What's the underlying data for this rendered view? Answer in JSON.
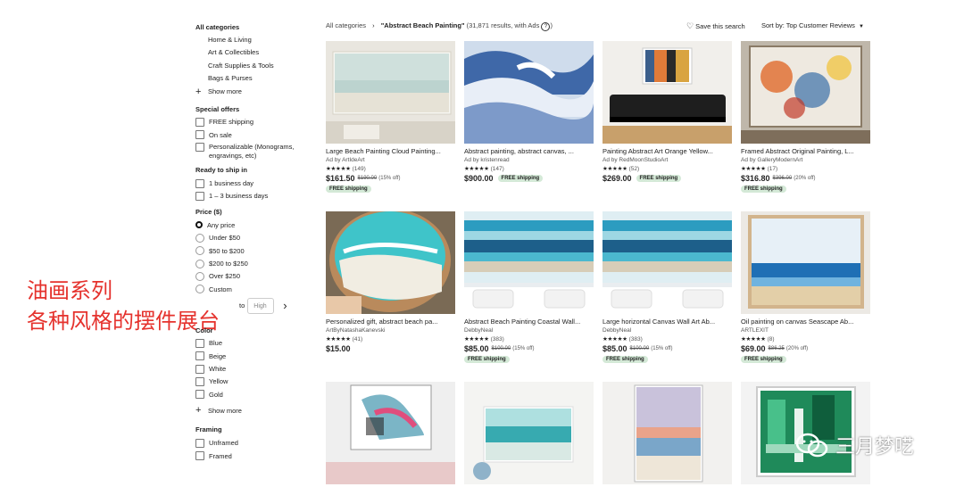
{
  "overlay": {
    "line1": "油画系列",
    "line2": "各种风格的摆件展台"
  },
  "watermark": {
    "icon": "wechat-icon",
    "text": "三月梦呓"
  },
  "sidebar": {
    "categories_title": "All categories",
    "categories": [
      "Home & Living",
      "Art & Collectibles",
      "Craft Supplies & Tools",
      "Bags & Purses"
    ],
    "show_more": "Show more",
    "special_title": "Special offers",
    "special": [
      "FREE shipping",
      "On sale",
      "Personalizable (Monograms, engravings, etc)"
    ],
    "ship_title": "Ready to ship in",
    "ship": [
      "1 business day",
      "1 – 3 business days"
    ],
    "price_title": "Price ($)",
    "price": [
      "Any price",
      "Under $50",
      "$50 to $200",
      "$200 to $250",
      "Over $250",
      "Custom"
    ],
    "price_to": "to",
    "price_high_placeholder": "High",
    "color_title": "Color",
    "colors": [
      "Blue",
      "Beige",
      "White",
      "Yellow",
      "Gold"
    ],
    "color_show_more": "Show more",
    "framing_title": "Framing",
    "framing": [
      "Unframed",
      "Framed"
    ]
  },
  "header": {
    "breadcrumb_root": "All categories",
    "breadcrumb_sep": "›",
    "query": "\"Abstract Beach Painting\"",
    "results": "(31,871 results, with Ads",
    "save_search": "Save this search",
    "sort": "Sort by: Top Customer Reviews"
  },
  "listings": [
    {
      "title": "Large Beach Painting Cloud Painting...",
      "shop": "Ad by ArtIdeArt",
      "stars": "★★★★★",
      "reviews": "(149)",
      "price": "$161.50",
      "orig": "$190.00",
      "off": "(15% off)",
      "ship": "FREE shipping",
      "ship_line": true
    },
    {
      "title": "Abstract painting, abstract canvas, ...",
      "shop": "Ad by kristenread",
      "stars": "★★★★★",
      "reviews": "(147)",
      "price": "$900.00",
      "orig": "",
      "off": "",
      "ship": "FREE shipping",
      "ship_line": false
    },
    {
      "title": "Painting Abstract Art Orange Yellow...",
      "shop": "Ad by RedMoonStudioArt",
      "stars": "★★★★★",
      "reviews": "(52)",
      "price": "$269.00",
      "orig": "",
      "off": "",
      "ship": "FREE shipping",
      "ship_line": false
    },
    {
      "title": "Framed Abstract Original Painting, L...",
      "shop": "Ad by GalleryModernArt",
      "stars": "★★★★★",
      "reviews": "(17)",
      "price": "$316.80",
      "orig": "$396.00",
      "off": "(20% off)",
      "ship": "FREE shipping",
      "ship_line": true
    },
    {
      "title": "Personalized gift, abstract beach pa...",
      "shop": "ArtByNatashaKanevski",
      "stars": "★★★★★",
      "reviews": "(41)",
      "price": "$15.00",
      "orig": "",
      "off": "",
      "ship": "",
      "ship_line": true
    },
    {
      "title": "Abstract Beach Painting Coastal Wall...",
      "shop": "DebbyNeal",
      "stars": "★★★★★",
      "reviews": "(383)",
      "price": "$85.00",
      "orig": "$100.00",
      "off": "(15% off)",
      "ship": "FREE shipping",
      "ship_line": true
    },
    {
      "title": "Large horizontal Canvas Wall Art Ab...",
      "shop": "DebbyNeal",
      "stars": "★★★★★",
      "reviews": "(383)",
      "price": "$85.00",
      "orig": "$100.00",
      "off": "(15% off)",
      "ship": "FREE shipping",
      "ship_line": true
    },
    {
      "title": "Oil painting on canvas Seascape Ab...",
      "shop": "ARTLEXIT",
      "stars": "★★★★★",
      "reviews": "(8)",
      "price": "$69.00",
      "orig": "$86.25",
      "off": "(20% off)",
      "ship": "FREE shipping",
      "ship_line": true
    },
    {
      "title": "",
      "shop": "",
      "stars": "",
      "reviews": "",
      "price": "",
      "orig": "",
      "off": "",
      "ship": "",
      "ship_line": true
    },
    {
      "title": "",
      "shop": "",
      "stars": "",
      "reviews": "",
      "price": "",
      "orig": "",
      "off": "",
      "ship": "",
      "ship_line": true
    },
    {
      "title": "",
      "shop": "",
      "stars": "",
      "reviews": "",
      "price": "",
      "orig": "",
      "off": "",
      "ship": "",
      "ship_line": true
    },
    {
      "title": "",
      "shop": "",
      "stars": "",
      "reviews": "",
      "price": "",
      "orig": "",
      "off": "",
      "ship": "",
      "ship_line": true
    }
  ]
}
